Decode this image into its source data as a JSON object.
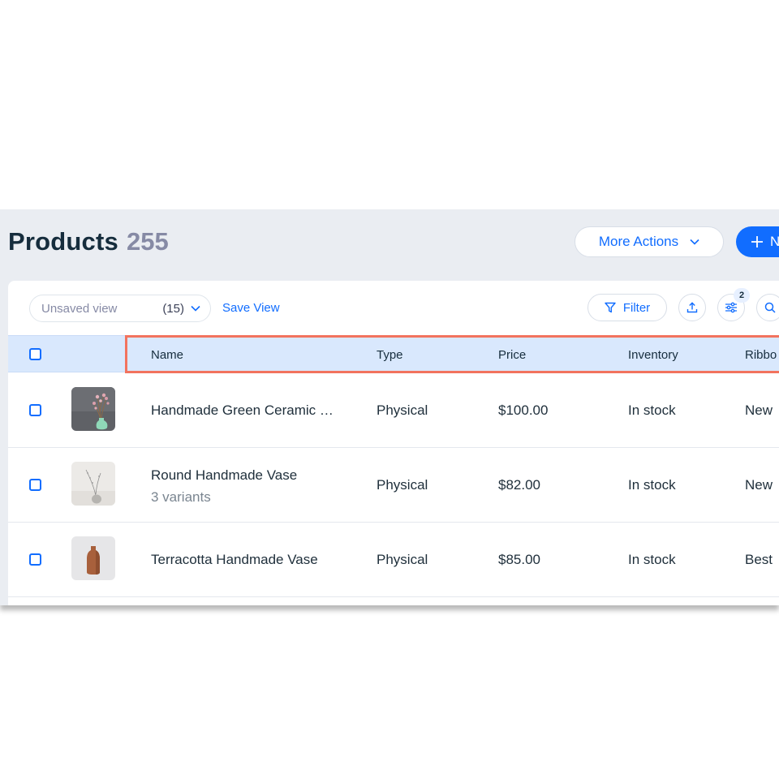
{
  "header": {
    "title": "Products",
    "count": "255",
    "more_actions_label": "More Actions",
    "new_button_label": "N"
  },
  "toolbar": {
    "view_label": "Unsaved view",
    "view_count": "(15)",
    "save_view_label": "Save View",
    "filter_label": "Filter",
    "customize_badge": "2"
  },
  "table": {
    "columns": [
      "Name",
      "Type",
      "Price",
      "Inventory",
      "Ribbo"
    ],
    "rows": [
      {
        "name": "Handmade Green Ceramic …",
        "variants": "",
        "type": "Physical",
        "price": "$100.00",
        "inventory": "In stock",
        "ribbon": "New"
      },
      {
        "name": "Round Handmade Vase",
        "variants": "3 variants",
        "type": "Physical",
        "price": "$82.00",
        "inventory": "In stock",
        "ribbon": "New"
      },
      {
        "name": "Terracotta Handmade Vase",
        "variants": "",
        "type": "Physical",
        "price": "$85.00",
        "inventory": "In stock",
        "ribbon": "Best"
      }
    ]
  },
  "colors": {
    "accent": "#116dff",
    "header_row_bg": "#d9e8fd",
    "highlight": "#f2735e",
    "panel_bg": "#eaedf2"
  }
}
